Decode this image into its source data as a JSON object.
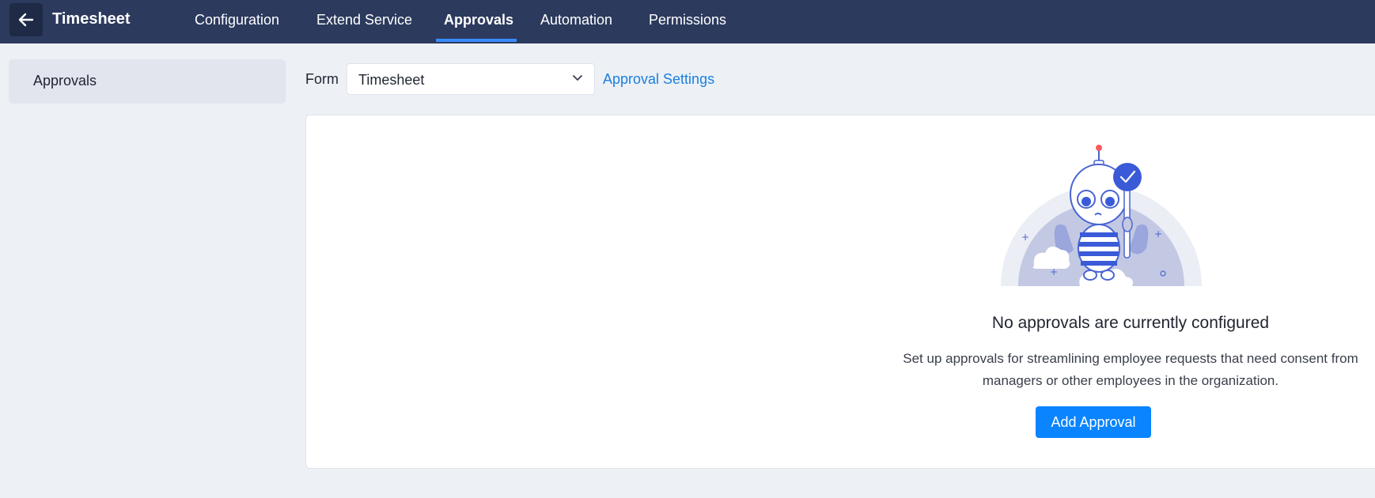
{
  "header": {
    "back_icon": "arrow-left-icon",
    "title": "Timesheet",
    "tabs": [
      {
        "label": "Configuration",
        "active": false
      },
      {
        "label": "Extend Service",
        "active": false
      },
      {
        "label": "Approvals",
        "active": true
      },
      {
        "label": "Automation",
        "active": false
      },
      {
        "label": "Permissions",
        "active": false
      }
    ]
  },
  "sidebar": {
    "items": [
      {
        "label": "Approvals",
        "selected": true
      }
    ]
  },
  "filter": {
    "form_label": "Form",
    "form_value": "Timesheet",
    "settings_link": "Approval Settings"
  },
  "empty_state": {
    "title": "No approvals are currently configured",
    "description_line1": "Set up approvals for streamlining employee requests that need consent from",
    "description_line2": "managers or other employees in the organization.",
    "button": "Add Approval"
  },
  "colors": {
    "topbar": "#2c3a5e",
    "accent": "#0a84ff",
    "link": "#1a7fe0",
    "background": "#edf0f5"
  }
}
